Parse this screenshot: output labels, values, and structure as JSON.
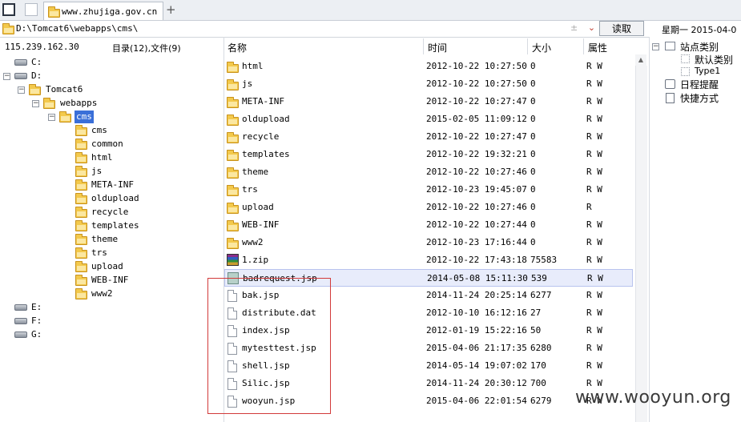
{
  "tab": {
    "title": "www.zhujiga.gov.cn"
  },
  "address": {
    "path": "D:\\Tomcat6\\webapps\\cms\\",
    "read_button": "读取",
    "date": "星期一  2015-04-0"
  },
  "tree": {
    "ip": "115.239.162.30",
    "count": "目录(12),文件(9)",
    "drives": [
      "C:",
      "D:",
      "E:",
      "F:",
      "G:"
    ],
    "d_children": {
      "tomcat": "Tomcat6",
      "webapps": "webapps",
      "cms": "cms"
    },
    "cms_children": [
      "cms",
      "common",
      "html",
      "js",
      "META-INF",
      "oldupload",
      "recycle",
      "templates",
      "theme",
      "trs",
      "upload",
      "WEB-INF",
      "www2"
    ]
  },
  "list": {
    "headers": {
      "name": "名称",
      "time": "时间",
      "size": "大小",
      "attr": "属性"
    },
    "rows": [
      {
        "name": "html",
        "time": "2012-10-22 10:27:50",
        "size": "0",
        "attr": "R W",
        "type": "folder"
      },
      {
        "name": "js",
        "time": "2012-10-22 10:27:50",
        "size": "0",
        "attr": "R W",
        "type": "folder"
      },
      {
        "name": "META-INF",
        "time": "2012-10-22 10:27:47",
        "size": "0",
        "attr": "R W",
        "type": "folder"
      },
      {
        "name": "oldupload",
        "time": "2015-02-05 11:09:12",
        "size": "0",
        "attr": "R W",
        "type": "folder"
      },
      {
        "name": "recycle",
        "time": "2012-10-22 10:27:47",
        "size": "0",
        "attr": "R W",
        "type": "folder"
      },
      {
        "name": "templates",
        "time": "2012-10-22 19:32:21",
        "size": "0",
        "attr": "R W",
        "type": "folder"
      },
      {
        "name": "theme",
        "time": "2012-10-22 10:27:46",
        "size": "0",
        "attr": "R W",
        "type": "folder"
      },
      {
        "name": "trs",
        "time": "2012-10-23 19:45:07",
        "size": "0",
        "attr": "R W",
        "type": "folder"
      },
      {
        "name": "upload",
        "time": "2012-10-22 10:27:46",
        "size": "0",
        "attr": "R",
        "type": "folder"
      },
      {
        "name": "WEB-INF",
        "time": "2012-10-22 10:27:44",
        "size": "0",
        "attr": "R W",
        "type": "folder"
      },
      {
        "name": "www2",
        "time": "2012-10-23 17:16:44",
        "size": "0",
        "attr": "R W",
        "type": "folder"
      },
      {
        "name": "1.zip",
        "time": "2012-10-22 17:43:18",
        "size": "75583",
        "attr": "R W",
        "type": "zip"
      },
      {
        "name": "badrequest.jsp",
        "time": "2014-05-08 15:11:30",
        "size": "539",
        "attr": "R W",
        "type": "jsp"
      },
      {
        "name": "bak.jsp",
        "time": "2014-11-24 20:25:14",
        "size": "6277",
        "attr": "R W",
        "type": "file"
      },
      {
        "name": "distribute.dat",
        "time": "2012-10-10 16:12:16",
        "size": "27",
        "attr": "R W",
        "type": "file"
      },
      {
        "name": "index.jsp",
        "time": "2012-01-19 15:22:16",
        "size": "50",
        "attr": "R W",
        "type": "file"
      },
      {
        "name": "mytesttest.jsp",
        "time": "2015-04-06 21:17:35",
        "size": "6280",
        "attr": "R W",
        "type": "file"
      },
      {
        "name": "shell.jsp",
        "time": "2014-05-14 19:07:02",
        "size": "170",
        "attr": "R W",
        "type": "file"
      },
      {
        "name": "Silic.jsp",
        "time": "2014-11-24 20:30:12",
        "size": "700",
        "attr": "R W",
        "type": "file"
      },
      {
        "name": "wooyun.jsp",
        "time": "2015-04-06 22:01:54",
        "size": "6279",
        "attr": "R W",
        "type": "file"
      }
    ]
  },
  "right_panel": {
    "category": "站点类别",
    "default_category": "默认类别",
    "type1": "Type1",
    "reminder": "日程提醒",
    "shortcut": "快捷方式"
  },
  "watermark": "www.wooyun.org"
}
